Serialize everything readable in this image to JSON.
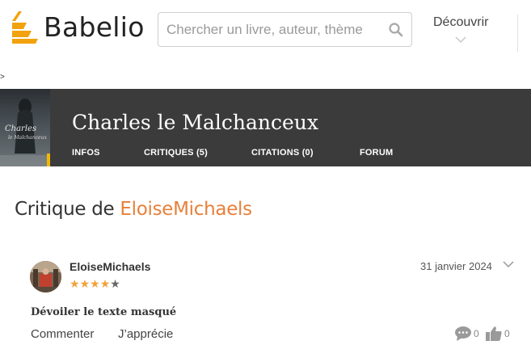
{
  "header": {
    "logo_text": "Babelio",
    "search_placeholder": "Chercher un livre, auteur, thème",
    "discover_label": "Découvrir"
  },
  "stray_char": ">",
  "book": {
    "title": "Charles le Malchanceux",
    "nav": [
      {
        "label": "INFOS"
      },
      {
        "label": "CRITIQUES (5)"
      },
      {
        "label": "CITATIONS (0)"
      },
      {
        "label": "FORUM"
      }
    ]
  },
  "critique": {
    "heading_prefix": "Critique de",
    "heading_author": "EloiseMichaels",
    "username": "EloiseMichaels",
    "rating": 4,
    "rating_max": 5,
    "date": "31 janvier 2024",
    "reveal_label": "Dévoiler le texte masqué",
    "comment_label": "Commenter",
    "like_label": "J’apprécie",
    "comment_count": "0",
    "like_count": "0"
  },
  "colors": {
    "accent": "#e8803a",
    "logo": "#f2a20c",
    "banner": "#3b3b3b",
    "star": "#f0a23a"
  }
}
